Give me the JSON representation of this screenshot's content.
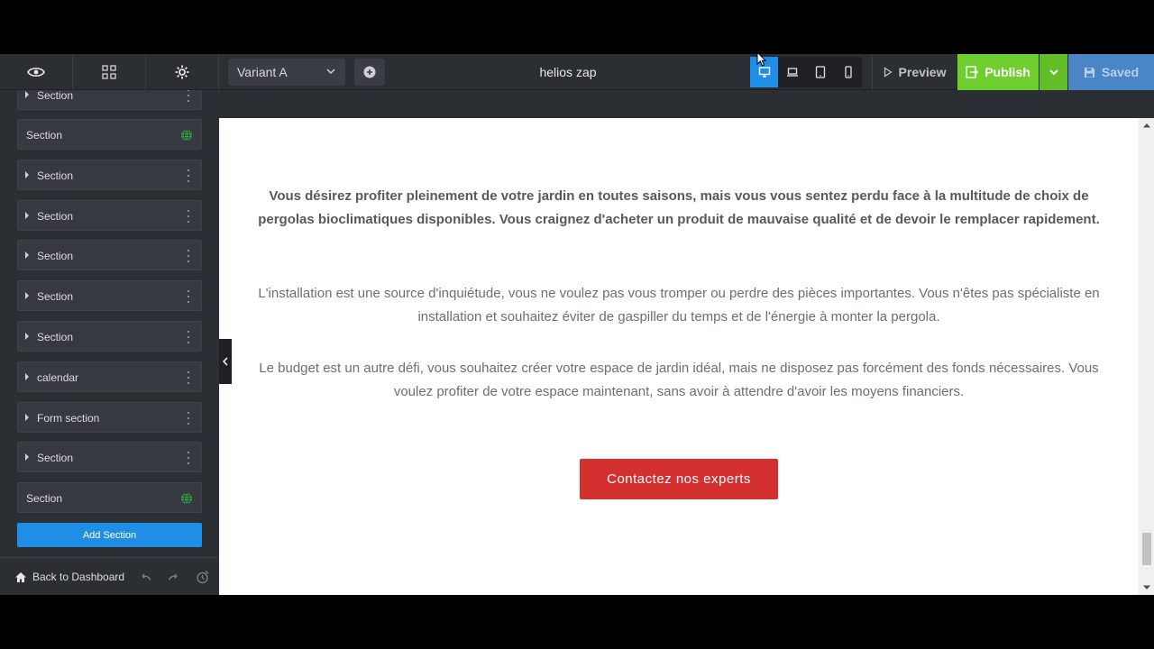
{
  "topbar": {
    "variant": "Variant A",
    "page_title": "helios zap",
    "preview": "Preview",
    "publish": "Publish",
    "saved": "Saved"
  },
  "sidebar": {
    "items": [
      {
        "label": "Section",
        "global": false
      },
      {
        "label": "Section",
        "global": true
      },
      {
        "label": "Section",
        "global": false
      },
      {
        "label": "Section",
        "global": false
      },
      {
        "label": "Section",
        "global": false
      },
      {
        "label": "Section",
        "global": false
      },
      {
        "label": "Section",
        "global": false
      },
      {
        "label": "calendar",
        "global": false
      },
      {
        "label": "Form section",
        "global": false
      },
      {
        "label": "Section",
        "global": false
      },
      {
        "label": "Section",
        "global": true
      }
    ],
    "add_section": "Add Section",
    "back_to_dashboard": "Back to Dashboard"
  },
  "canvas": {
    "paragraph1": "Vous désirez profiter pleinement de votre jardin en toutes saisons, mais vous vous sentez perdu face à la multitude de choix de pergolas bioclimatiques disponibles. Vous craignez d'acheter un produit de mauvaise qualité et de devoir le remplacer rapidement.",
    "paragraph2": "L'installation est une source d'inquiétude, vous ne voulez pas vous tromper ou perdre des pièces importantes. Vous n'êtes pas spécialiste en installation et souhaitez éviter de gaspiller du temps et de l'énergie à monter la pergola.",
    "paragraph3": "Le budget est un autre défi, vous souhaitez créer votre espace de jardin idéal, mais ne disposez pas forcément des fonds nécessaires. Vous voulez profiter de votre espace maintenant, sans avoir à attendre d'avoir les moyens financiers.",
    "cta": "Contactez nos experts"
  },
  "colors": {
    "accent_blue": "#1f8ee6",
    "publish_green": "#6fcf2f",
    "saved_blue": "#4a86c5",
    "cta_red": "#d3302f",
    "global_green": "#2ea84a"
  }
}
